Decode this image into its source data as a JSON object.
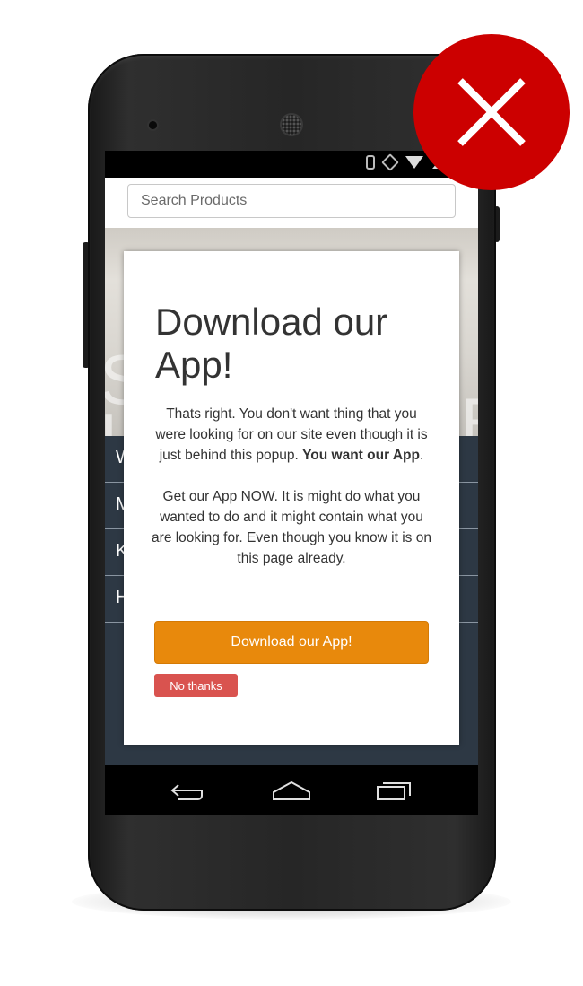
{
  "search": {
    "placeholder": "Search Products"
  },
  "hero": {
    "line1": "S",
    "line2": "L",
    "line3": "E"
  },
  "menu": {
    "items": [
      {
        "label": "W"
      },
      {
        "label": "M"
      },
      {
        "label": "K"
      },
      {
        "label": "H"
      }
    ]
  },
  "popup": {
    "title": "Download our App!",
    "paragraph1_text": "Thats right. You don't want thing that you were looking for on our site even though it is just behind this popup. ",
    "paragraph1_bold": "You want our App",
    "paragraph1_end": ".",
    "paragraph2": "Get our App NOW. It is might do what you wanted to do and it might contain what you are looking for. Even though you know it is on this page already.",
    "download_button": "Download our App!",
    "no_thanks_button": "No thanks"
  },
  "colors": {
    "download_button": "#e8890c",
    "no_thanks_button": "#d9534f",
    "badge": "#cc0000",
    "page_menu_bg": "#2d3844"
  },
  "icons": {
    "status": [
      "bluetooth-icon",
      "rotation-icon",
      "wifi-icon",
      "signal-icon",
      "battery-icon"
    ],
    "navigation": [
      "back-icon",
      "home-icon",
      "recents-icon"
    ],
    "badge": "close-icon"
  }
}
